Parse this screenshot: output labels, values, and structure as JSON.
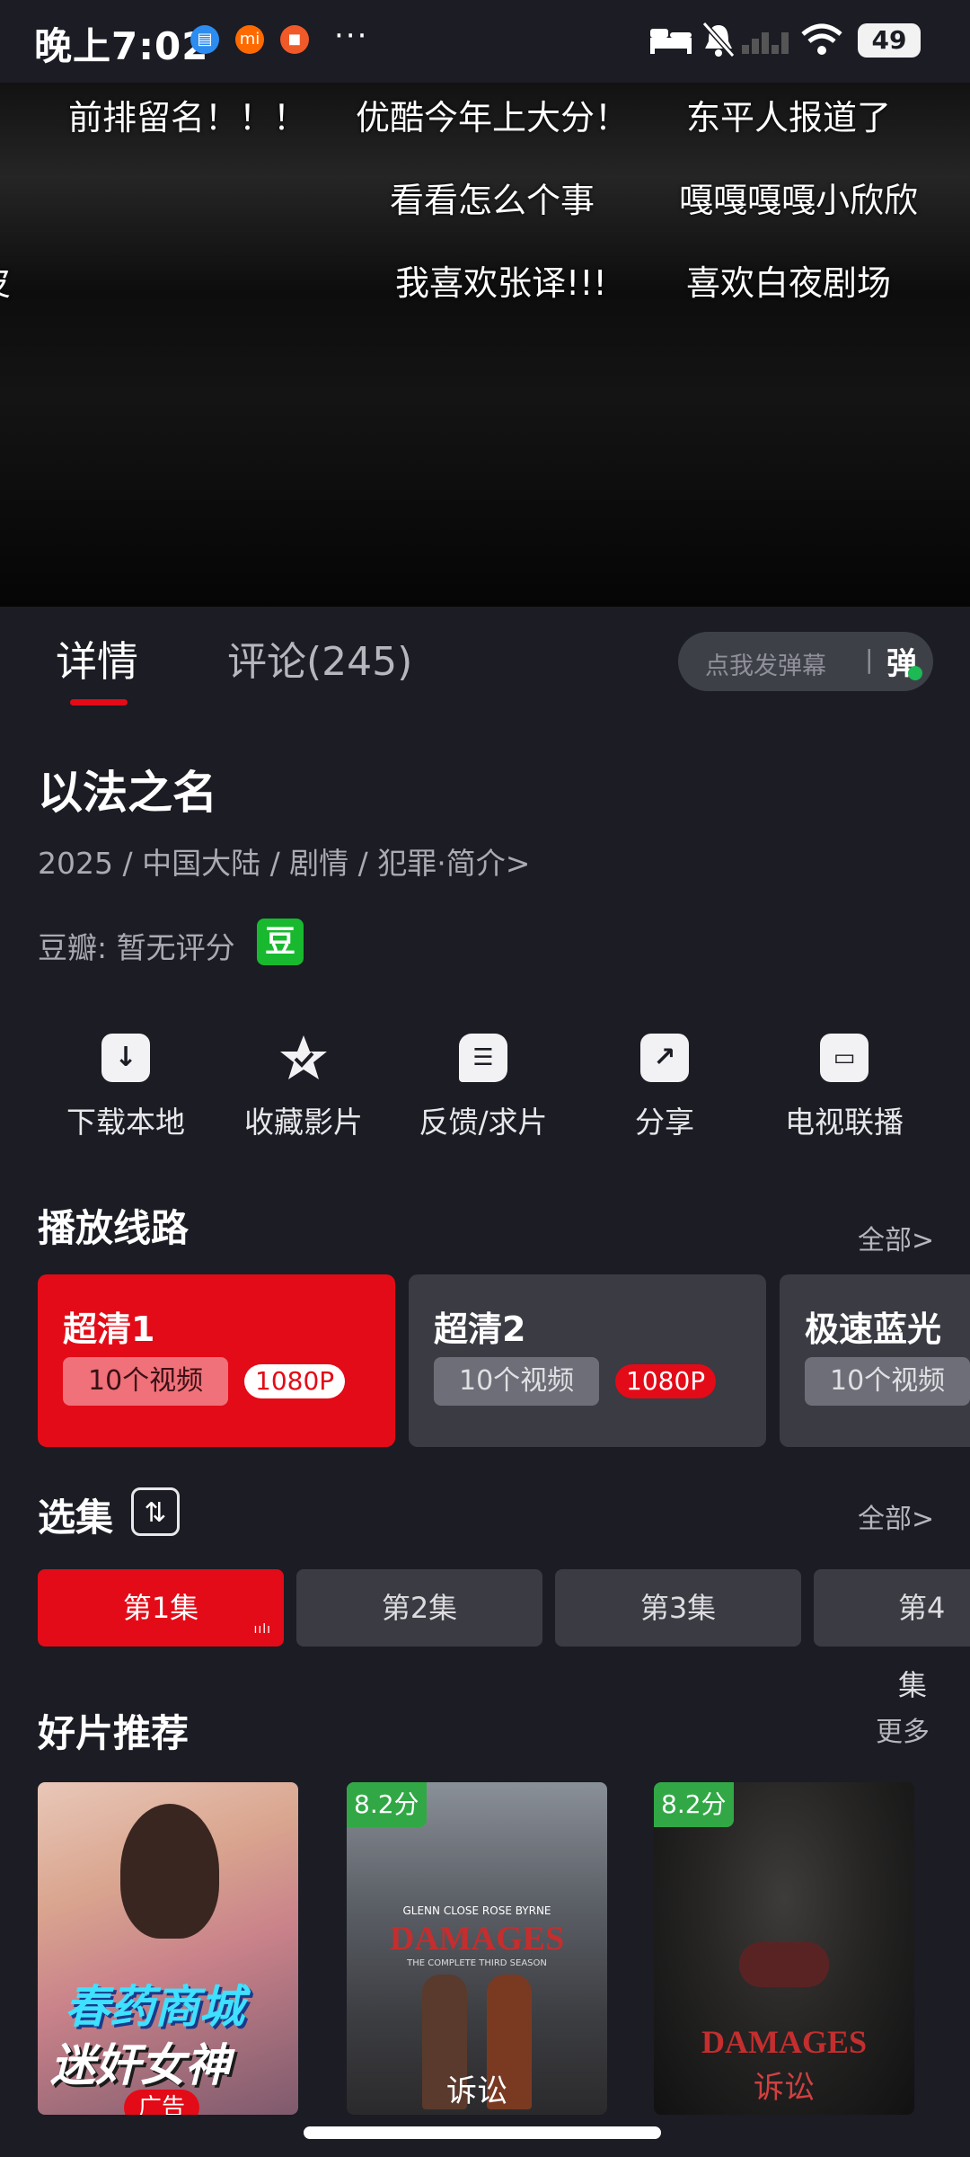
{
  "status_bar": {
    "time": "晚上7:02",
    "more": "···",
    "battery": "49"
  },
  "danmaku": [
    "前排留名！！！",
    "优酷今年上大分！",
    "东平人报道了",
    "看看怎么个事",
    "嘎嘎嘎嘎小欣欣",
    "我喜欢张译!!!",
    "喜欢白夜剧场",
    "皮"
  ],
  "tabs": {
    "detail": "详情",
    "comments": "评论(245)"
  },
  "danmaku_send": {
    "placeholder": "点我发弹幕",
    "separator": "|",
    "icon": "弹"
  },
  "show": {
    "title": "以法之名",
    "meta": "2025 / 中国大陆 / 剧情 / 犯罪·简介>",
    "douban_label": "豆瓣:  暂无评分",
    "douban_badge": "豆"
  },
  "actions": [
    {
      "label": "下载本地",
      "icon": "download-icon"
    },
    {
      "label": "收藏影片",
      "icon": "star-icon"
    },
    {
      "label": "反馈/求片",
      "icon": "feedback-icon"
    },
    {
      "label": "分享",
      "icon": "share-icon"
    },
    {
      "label": "电视联播",
      "icon": "tv-cast-icon"
    }
  ],
  "lines": {
    "title": "播放线路",
    "more": "全部>",
    "items": [
      {
        "name": "超清1",
        "count": "10个视频",
        "res": "1080P"
      },
      {
        "name": "超清2",
        "count": "10个视频",
        "res": "1080P"
      },
      {
        "name": "极速蓝光",
        "count": "10个视频"
      }
    ]
  },
  "episodes": {
    "title": "选集",
    "more": "全部>",
    "items": [
      "第1集",
      "第2集",
      "第3集",
      "第4集"
    ]
  },
  "recommend": {
    "title": "好片推荐",
    "more": "更多",
    "items": [
      {
        "ad_line1": "春药商城",
        "ad_line2": "迷奸女神",
        "ad_tag": "广告"
      },
      {
        "rating": "8.2分",
        "credits": "GLENN CLOSE   ROSE BYRNE",
        "logo": "DAMAGES",
        "subtitle": "THE COMPLETE THIRD SEASON",
        "cn_title": "诉讼"
      },
      {
        "rating": "8.2分",
        "logo": "DAMAGES",
        "cn_title": "诉讼"
      }
    ]
  },
  "colors": {
    "accent": "#e30b17",
    "background": "#1b1c24",
    "card": "#3a3b43",
    "rating_green": "#31a845",
    "douban_green": "#18b92e"
  }
}
